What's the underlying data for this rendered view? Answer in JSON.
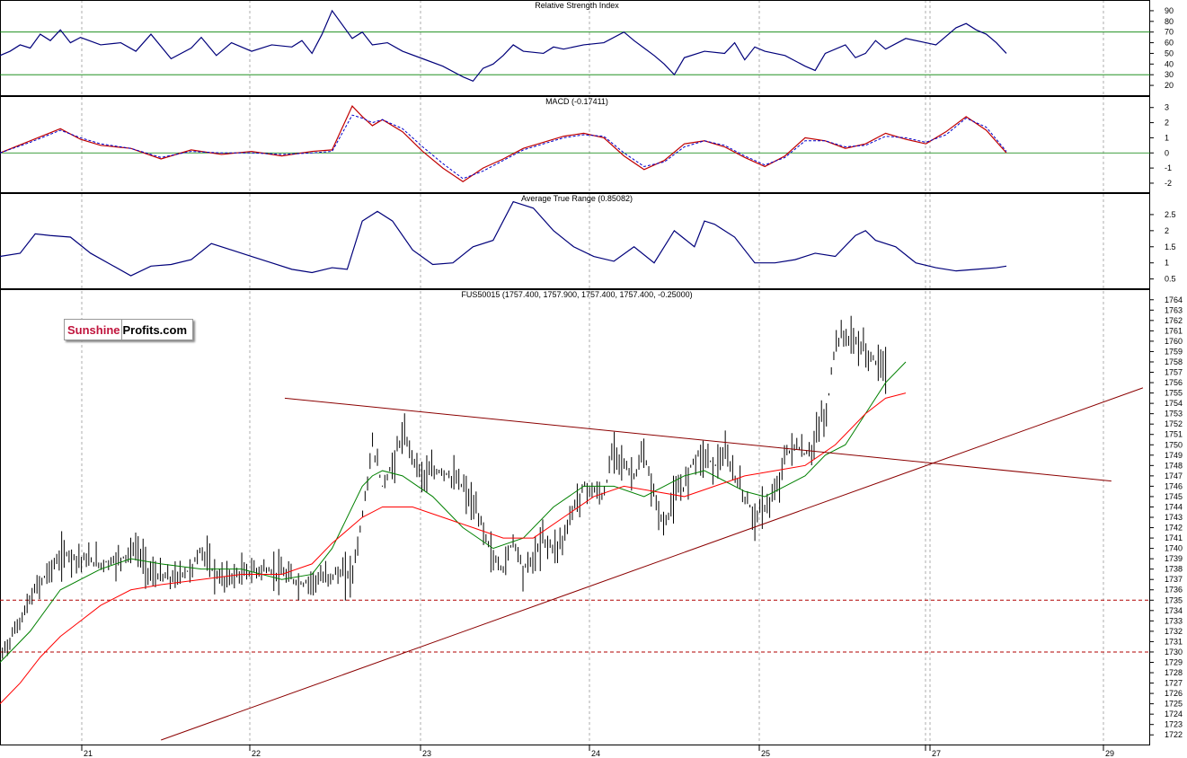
{
  "colors": {
    "price_bars": "#000000",
    "sma_fast": "#008000",
    "sma_slow": "#ff0000",
    "rsi_line": "#00007a",
    "macd_line": "#c00000",
    "macd_signal": "#0000cc",
    "atr_line": "#00007a",
    "trendline": "#8b0000",
    "support_lines": "#b00000",
    "reference_lines": "#008000",
    "grid": "#999999"
  },
  "logo": {
    "part1": "Sunshine",
    "part2": "Profits.com"
  },
  "x_axis": {
    "labels": [
      "21",
      "22",
      "23",
      "24",
      "25",
      "",
      "27",
      "29"
    ]
  },
  "chart_data": [
    {
      "type": "line",
      "title": "Relative Strength Index",
      "ylim": [
        15,
        95
      ],
      "yticks": [
        20,
        30,
        40,
        50,
        60,
        70,
        80,
        90
      ],
      "reference_levels": [
        30,
        70
      ],
      "grid": "vertical-dashed",
      "series": [
        {
          "x": [
            0,
            0.01,
            0.02,
            0.03,
            0.04,
            0.05,
            0.06,
            0.07,
            0.08,
            0.1,
            0.12,
            0.135,
            0.15,
            0.17,
            0.19,
            0.2,
            0.215,
            0.23,
            0.25,
            0.27,
            0.29,
            0.3,
            0.31,
            0.32,
            0.33,
            0.35,
            0.36,
            0.37,
            0.385,
            0.4,
            0.42,
            0.44,
            0.46,
            0.47,
            0.48,
            0.49,
            0.5,
            0.51,
            0.52,
            0.54,
            0.55,
            0.56,
            0.58,
            0.6,
            0.62,
            0.63,
            0.64,
            0.65,
            0.66,
            0.67,
            0.68,
            0.7,
            0.72,
            0.73,
            0.74,
            0.75,
            0.76,
            0.78,
            0.8,
            0.81,
            0.82,
            0.84,
            0.85,
            0.86,
            0.87,
            0.88,
            0.9,
            0.92,
            0.93,
            0.94,
            0.95,
            0.96,
            0.97,
            0.98,
            0.99,
            1.0
          ],
          "values": [
            48,
            52,
            58,
            55,
            68,
            62,
            72,
            60,
            65,
            58,
            60,
            52,
            68,
            45,
            55,
            65,
            48,
            60,
            52,
            58,
            56,
            62,
            50,
            68,
            90,
            64,
            70,
            58,
            60,
            52,
            45,
            38,
            28,
            24,
            36,
            40,
            48,
            58,
            52,
            50,
            56,
            54,
            58,
            60,
            70,
            62,
            55,
            48,
            40,
            30,
            46,
            52,
            50,
            60,
            44,
            56,
            52,
            48,
            38,
            34,
            50,
            58,
            46,
            50,
            62,
            54,
            64,
            60,
            58,
            66,
            74,
            78,
            72,
            68,
            60,
            50
          ]
        }
      ]
    },
    {
      "type": "line",
      "title": "MACD (-0.17411)",
      "ylim": [
        -2.3,
        3.4
      ],
      "yticks": [
        -2,
        -1,
        0,
        1,
        2,
        3
      ],
      "reference_levels": [
        0
      ],
      "series": [
        {
          "x": [
            0,
            0.03,
            0.06,
            0.08,
            0.1,
            0.13,
            0.16,
            0.19,
            0.22,
            0.25,
            0.28,
            0.31,
            0.33,
            0.35,
            0.36,
            0.37,
            0.38,
            0.4,
            0.42,
            0.44,
            0.46,
            0.48,
            0.5,
            0.52,
            0.54,
            0.56,
            0.58,
            0.6,
            0.62,
            0.64,
            0.66,
            0.68,
            0.7,
            0.72,
            0.74,
            0.76,
            0.78,
            0.8,
            0.82,
            0.84,
            0.86,
            0.88,
            0.9,
            0.92,
            0.94,
            0.96,
            0.98,
            1.0
          ],
          "values": [
            0,
            0.8,
            1.6,
            0.9,
            0.5,
            0.3,
            -0.4,
            0.2,
            -0.1,
            0.1,
            -0.2,
            0.1,
            0.2,
            3.1,
            2.4,
            1.8,
            2.2,
            1.4,
            0.1,
            -1.0,
            -1.9,
            -1.0,
            -0.4,
            0.3,
            0.7,
            1.1,
            1.3,
            1.0,
            -0.2,
            -1.1,
            -0.5,
            0.6,
            0.8,
            0.4,
            -0.3,
            -0.9,
            -0.2,
            1.0,
            0.8,
            0.3,
            0.6,
            1.3,
            0.9,
            0.6,
            1.4,
            2.4,
            1.5,
            0
          ]
        },
        {
          "x": [
            0,
            0.03,
            0.06,
            0.08,
            0.1,
            0.13,
            0.16,
            0.19,
            0.22,
            0.25,
            0.28,
            0.31,
            0.33,
            0.35,
            0.36,
            0.37,
            0.38,
            0.4,
            0.42,
            0.44,
            0.46,
            0.48,
            0.5,
            0.52,
            0.54,
            0.56,
            0.58,
            0.6,
            0.62,
            0.64,
            0.66,
            0.68,
            0.7,
            0.72,
            0.74,
            0.76,
            0.78,
            0.8,
            0.82,
            0.84,
            0.86,
            0.88,
            0.9,
            0.92,
            0.94,
            0.96,
            0.98,
            1.0
          ],
          "values": [
            0,
            0.7,
            1.5,
            1.0,
            0.6,
            0.3,
            -0.3,
            0.1,
            0,
            0,
            -0.1,
            0,
            0.1,
            2.5,
            2.3,
            2.0,
            2.2,
            1.6,
            0.4,
            -0.7,
            -1.7,
            -1.2,
            -0.5,
            0.2,
            0.6,
            1.0,
            1.2,
            1.1,
            0,
            -0.9,
            -0.6,
            0.4,
            0.8,
            0.5,
            -0.2,
            -0.8,
            -0.3,
            0.8,
            0.8,
            0.4,
            0.5,
            1.1,
            1.0,
            0.7,
            1.2,
            2.3,
            1.7,
            0.1
          ]
        }
      ]
    },
    {
      "type": "line",
      "title": "Average True Range (0.85082)",
      "ylim": [
        0.35,
        3.0
      ],
      "yticks": [
        0.5,
        1.0,
        1.5,
        2.0,
        2.5
      ],
      "series": [
        {
          "x": [
            0,
            0.02,
            0.035,
            0.05,
            0.07,
            0.09,
            0.11,
            0.13,
            0.15,
            0.17,
            0.19,
            0.21,
            0.23,
            0.25,
            0.27,
            0.29,
            0.31,
            0.33,
            0.345,
            0.36,
            0.375,
            0.39,
            0.41,
            0.43,
            0.45,
            0.47,
            0.49,
            0.51,
            0.52,
            0.53,
            0.55,
            0.57,
            0.59,
            0.61,
            0.63,
            0.65,
            0.67,
            0.69,
            0.7,
            0.71,
            0.73,
            0.75,
            0.77,
            0.79,
            0.81,
            0.83,
            0.85,
            0.86,
            0.87,
            0.89,
            0.91,
            0.93,
            0.95,
            0.97,
            0.99,
            1.0
          ],
          "values": [
            1.2,
            1.3,
            1.9,
            1.85,
            1.8,
            1.3,
            0.95,
            0.6,
            0.9,
            0.95,
            1.1,
            1.6,
            1.4,
            1.2,
            1.0,
            0.8,
            0.7,
            0.85,
            0.8,
            2.3,
            2.6,
            2.3,
            1.4,
            0.95,
            1.0,
            1.5,
            1.7,
            2.9,
            2.8,
            2.7,
            2.0,
            1.5,
            1.2,
            1.05,
            1.5,
            1.0,
            2.0,
            1.5,
            2.3,
            2.2,
            1.8,
            1.0,
            1.0,
            1.1,
            1.3,
            1.2,
            1.85,
            2.0,
            1.7,
            1.5,
            1.0,
            0.85,
            0.75,
            0.8,
            0.85,
            0.9
          ]
        }
      ]
    },
    {
      "type": "bar",
      "title": "FUS50015 (1757.400, 1757.900, 1757.400, 1757.400, -0.25000)",
      "ylim": [
        1721.5,
        1764.5
      ],
      "yticks": [
        1722,
        1723,
        1724,
        1725,
        1726,
        1727,
        1728,
        1729,
        1730,
        1731,
        1732,
        1733,
        1734,
        1735,
        1736,
        1737,
        1738,
        1739,
        1740,
        1741,
        1742,
        1743,
        1744,
        1745,
        1746,
        1747,
        1748,
        1749,
        1750,
        1751,
        1752,
        1753,
        1754,
        1755,
        1756,
        1757,
        1758,
        1759,
        1760,
        1761,
        1762,
        1763,
        1764
      ],
      "support_levels": [
        1735,
        1730
      ],
      "trendlines": [
        {
          "name": "",
          "from": [
            0.283,
            1754.5
          ],
          "to": [
            0.957,
            1746.5
          ]
        },
        {
          "name": "",
          "from": [
            0.16,
            1721.5
          ],
          "to": [
            1.0,
            1755.5
          ]
        }
      ],
      "price_path": {
        "x": [
          0,
          0.02,
          0.035,
          0.05,
          0.065,
          0.08,
          0.1,
          0.12,
          0.135,
          0.15,
          0.17,
          0.19,
          0.2,
          0.21,
          0.22,
          0.24,
          0.26,
          0.28,
          0.29,
          0.3,
          0.31,
          0.315,
          0.32,
          0.33,
          0.35,
          0.36,
          0.37,
          0.38,
          0.39,
          0.4,
          0.42,
          0.44,
          0.46,
          0.47,
          0.48,
          0.49,
          0.5,
          0.51,
          0.52,
          0.53,
          0.54,
          0.55,
          0.56,
          0.57,
          0.58,
          0.6,
          0.61,
          0.62,
          0.63,
          0.64,
          0.65,
          0.66,
          0.67,
          0.68,
          0.69,
          0.7,
          0.71,
          0.72,
          0.73,
          0.74,
          0.75,
          0.76,
          0.77,
          0.78,
          0.79,
          0.8,
          0.81,
          0.815,
          0.82,
          0.825,
          0.83,
          0.84,
          0.85,
          0.86,
          0.87,
          0.88,
          0.89,
          0.9,
          0.91,
          0.92,
          0.93,
          0.94,
          0.95,
          0.96,
          0.97,
          0.98,
          1.0
        ],
        "values": [
          1729.5,
          1733,
          1736,
          1738,
          1739.5,
          1739,
          1738.5,
          1739,
          1740,
          1737.5,
          1737,
          1738,
          1740,
          1738,
          1737,
          1737.5,
          1738,
          1737.5,
          1737,
          1736.5,
          1737,
          1737,
          1737,
          1737.5,
          1737.5,
          1743,
          1750,
          1746,
          1748,
          1751,
          1747,
          1747.5,
          1746,
          1744,
          1742,
          1739,
          1738,
          1741,
          1738,
          1739,
          1741,
          1740,
          1741,
          1744,
          1746,
          1745,
          1750,
          1748,
          1747,
          1749,
          1745,
          1742,
          1745,
          1746,
          1749,
          1749,
          1748,
          1749,
          1747,
          1745,
          1743,
          1744,
          1745,
          1749,
          1750,
          1749,
          1750,
          1753,
          1752,
          1756,
          1760,
          1760.5,
          1760,
          1759,
          1758,
          1757.5,
          1757.5,
          1757.5,
          1757.5,
          1757.5,
          1757.5,
          1757.5,
          1757.5,
          1757.5,
          1757.5,
          1757.5,
          1757.5
        ]
      },
      "sma_fast": {
        "x": [
          0,
          0.03,
          0.06,
          0.1,
          0.13,
          0.16,
          0.2,
          0.24,
          0.28,
          0.31,
          0.33,
          0.35,
          0.36,
          0.37,
          0.38,
          0.4,
          0.43,
          0.46,
          0.49,
          0.52,
          0.55,
          0.58,
          0.61,
          0.64,
          0.66,
          0.68,
          0.7,
          0.72,
          0.74,
          0.76,
          0.78,
          0.8,
          0.82,
          0.84,
          0.86,
          0.88,
          0.9
        ],
        "values": [
          1729,
          1732,
          1736,
          1738,
          1739,
          1738.5,
          1738,
          1738,
          1737,
          1737.5,
          1740,
          1744,
          1746,
          1747,
          1747.5,
          1747,
          1745,
          1742,
          1740,
          1741,
          1744,
          1746,
          1746,
          1745,
          1746,
          1747,
          1747.5,
          1746.5,
          1745.5,
          1745,
          1746,
          1747,
          1749,
          1750,
          1753,
          1756,
          1758
        ]
      },
      "sma_slow": {
        "x": [
          0,
          0.02,
          0.04,
          0.06,
          0.08,
          0.1,
          0.13,
          0.16,
          0.2,
          0.24,
          0.28,
          0.31,
          0.33,
          0.36,
          0.38,
          0.41,
          0.44,
          0.47,
          0.5,
          0.53,
          0.56,
          0.59,
          0.62,
          0.65,
          0.68,
          0.71,
          0.74,
          0.77,
          0.8,
          0.83,
          0.86,
          0.88,
          0.9,
          0.91
        ],
        "values": [
          1725,
          1727,
          1729.5,
          1731.5,
          1733,
          1734.5,
          1736,
          1736.5,
          1737,
          1737.5,
          1737.5,
          1738.5,
          1740.5,
          1743,
          1744,
          1744,
          1743,
          1742,
          1741,
          1741,
          1743,
          1745,
          1746,
          1745.5,
          1745,
          1746,
          1747,
          1747.5,
          1748,
          1750,
          1753,
          1754.5,
          1755
        ]
      }
    }
  ]
}
